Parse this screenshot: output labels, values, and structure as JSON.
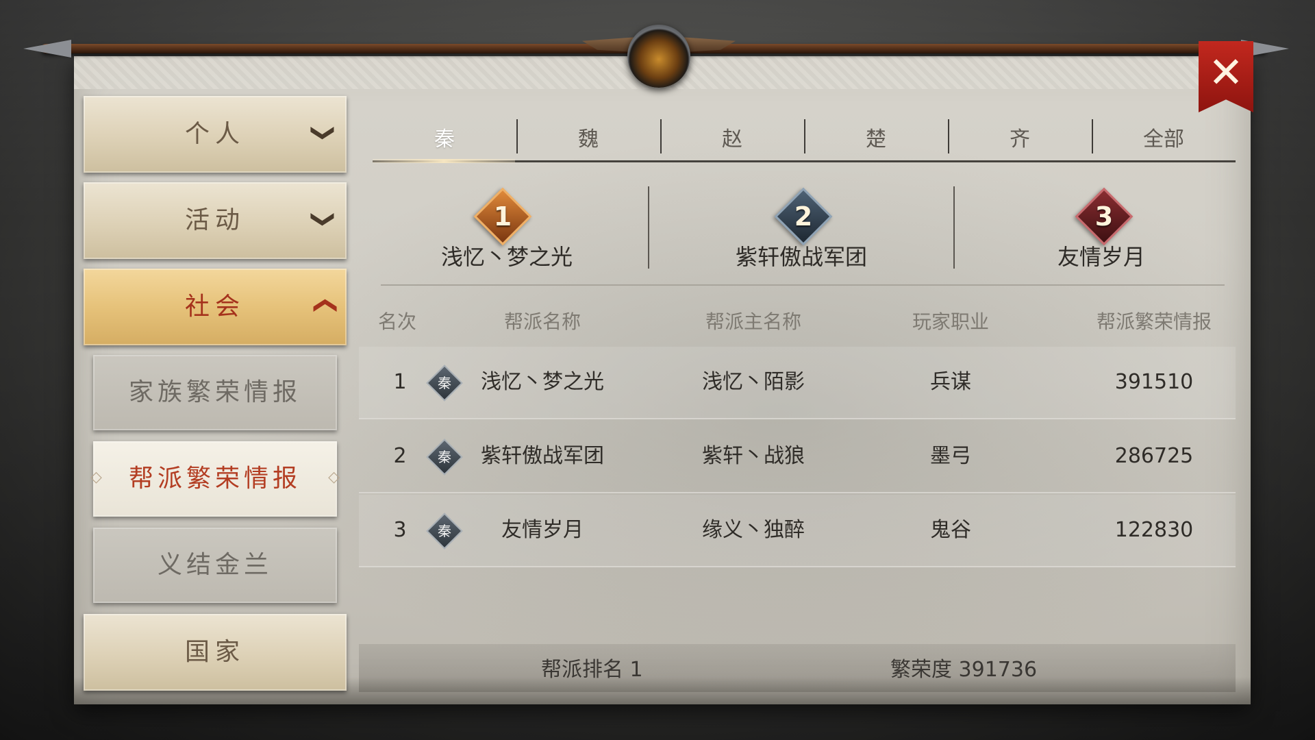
{
  "close_label": "✕",
  "sidebar": {
    "items": [
      {
        "label": "个人",
        "chevron": "❯"
      },
      {
        "label": "活动",
        "chevron": "❯"
      },
      {
        "label": "社会",
        "chevron": "❯"
      },
      {
        "label": "国家"
      }
    ],
    "subitems": [
      {
        "label": "家族繁荣情报"
      },
      {
        "label": "帮派繁荣情报"
      },
      {
        "label": "义结金兰"
      }
    ]
  },
  "tabs": [
    "秦",
    "魏",
    "赵",
    "楚",
    "齐",
    "全部"
  ],
  "podium": [
    {
      "rank": "1",
      "name": "浅忆丶梦之光",
      "color": "#c9682a"
    },
    {
      "rank": "2",
      "name": "紫轩傲战军团",
      "color": "#3b4b5c"
    },
    {
      "rank": "3",
      "name": "友情岁月",
      "color": "#6d2326"
    }
  ],
  "table": {
    "headers": [
      "名次",
      "帮派名称",
      "帮派主名称",
      "玩家职业",
      "帮派繁荣情报"
    ],
    "rows": [
      {
        "rank": "1",
        "state": "秦",
        "gang": "浅忆丶梦之光",
        "leader": "浅忆丶陌影",
        "job": "兵谋",
        "score": "391510"
      },
      {
        "rank": "2",
        "state": "秦",
        "gang": "紫轩傲战军团",
        "leader": "紫轩丶战狼",
        "job": "墨弓",
        "score": "286725"
      },
      {
        "rank": "3",
        "state": "秦",
        "gang": "友情岁月",
        "leader": "缘义丶独醉",
        "job": "鬼谷",
        "score": "122830"
      }
    ]
  },
  "footer": {
    "my_rank": "帮派排名 1",
    "prosperity": "繁荣度 391736"
  }
}
